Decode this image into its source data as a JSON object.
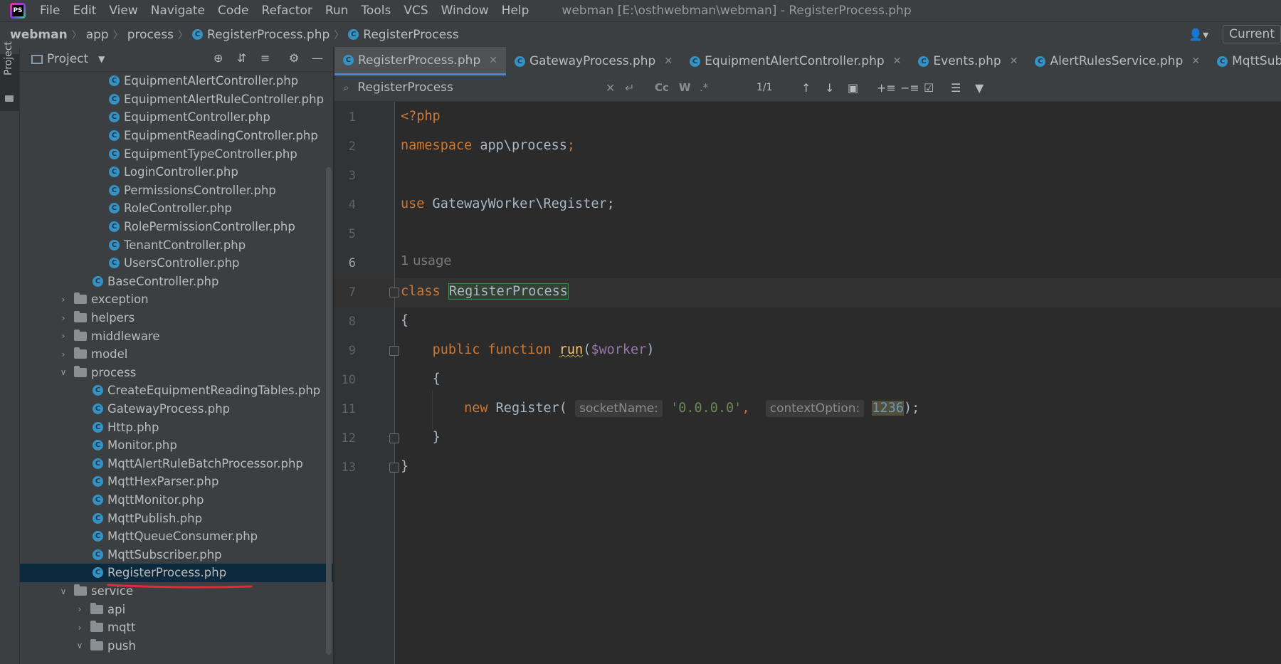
{
  "menu": {
    "items": [
      "File",
      "Edit",
      "View",
      "Navigate",
      "Code",
      "Refactor",
      "Run",
      "Tools",
      "VCS",
      "Window",
      "Help"
    ],
    "window_title": "webman [E:\\osthwebman\\webman] - RegisterProcess.php"
  },
  "breadcrumb": {
    "items": [
      "webman",
      "app",
      "process",
      "RegisterProcess.php",
      "RegisterProcess"
    ],
    "current_button": "Current"
  },
  "toolstrip": {
    "project_label": "Project"
  },
  "project_panel": {
    "title": "Project",
    "tree": [
      {
        "label": "EquipmentAlertController.php",
        "type": "file",
        "depth": 3
      },
      {
        "label": "EquipmentAlertRuleController.php",
        "type": "file",
        "depth": 3
      },
      {
        "label": "EquipmentController.php",
        "type": "file",
        "depth": 3
      },
      {
        "label": "EquipmentReadingController.php",
        "type": "file",
        "depth": 3
      },
      {
        "label": "EquipmentTypeController.php",
        "type": "file",
        "depth": 3
      },
      {
        "label": "LoginController.php",
        "type": "file",
        "depth": 3
      },
      {
        "label": "PermissionsController.php",
        "type": "file",
        "depth": 3
      },
      {
        "label": "RoleController.php",
        "type": "file",
        "depth": 3
      },
      {
        "label": "RolePermissionController.php",
        "type": "file",
        "depth": 3
      },
      {
        "label": "TenantController.php",
        "type": "file",
        "depth": 3
      },
      {
        "label": "UsersController.php",
        "type": "file",
        "depth": 3
      },
      {
        "label": "BaseController.php",
        "type": "file",
        "depth": 2
      },
      {
        "label": "exception",
        "type": "folder",
        "depth": 1,
        "expanded": false
      },
      {
        "label": "helpers",
        "type": "folder",
        "depth": 1,
        "expanded": false
      },
      {
        "label": "middleware",
        "type": "folder",
        "depth": 1,
        "expanded": false
      },
      {
        "label": "model",
        "type": "folder",
        "depth": 1,
        "expanded": false
      },
      {
        "label": "process",
        "type": "folder",
        "depth": 1,
        "expanded": true
      },
      {
        "label": "CreateEquipmentReadingTables.php",
        "type": "file",
        "depth": 2
      },
      {
        "label": "GatewayProcess.php",
        "type": "file",
        "depth": 2
      },
      {
        "label": "Http.php",
        "type": "file",
        "depth": 2
      },
      {
        "label": "Monitor.php",
        "type": "file",
        "depth": 2
      },
      {
        "label": "MqttAlertRuleBatchProcessor.php",
        "type": "file",
        "depth": 2
      },
      {
        "label": "MqttHexParser.php",
        "type": "file",
        "depth": 2
      },
      {
        "label": "MqttMonitor.php",
        "type": "file",
        "depth": 2
      },
      {
        "label": "MqttPublish.php",
        "type": "file",
        "depth": 2
      },
      {
        "label": "MqttQueueConsumer.php",
        "type": "file",
        "depth": 2
      },
      {
        "label": "MqttSubscriber.php",
        "type": "file",
        "depth": 2
      },
      {
        "label": "RegisterProcess.php",
        "type": "file",
        "depth": 2,
        "selected": true
      },
      {
        "label": "service",
        "type": "folder",
        "depth": 1,
        "expanded": true
      },
      {
        "label": "api",
        "type": "folder",
        "depth": 2,
        "expanded": false
      },
      {
        "label": "mqtt",
        "type": "folder",
        "depth": 2,
        "expanded": false
      },
      {
        "label": "push",
        "type": "folder",
        "depth": 2,
        "expanded": true
      }
    ]
  },
  "tabs": [
    {
      "label": "RegisterProcess.php",
      "active": true
    },
    {
      "label": "GatewayProcess.php",
      "active": false
    },
    {
      "label": "EquipmentAlertController.php",
      "active": false
    },
    {
      "label": "Events.php",
      "active": false
    },
    {
      "label": "AlertRulesService.php",
      "active": false
    },
    {
      "label": "MqttSubscriber.php",
      "active": false
    }
  ],
  "search": {
    "value": "RegisterProcess",
    "match_count": "1/1",
    "opt_case": "Cc",
    "opt_words": "W",
    "opt_regex": ".*"
  },
  "editor": {
    "line_numbers": [
      "1",
      "2",
      "3",
      "4",
      "5",
      "6",
      "7",
      "8",
      "9",
      "10",
      "11",
      "12",
      "13"
    ],
    "current_line": "6",
    "usage_hint": "1 usage",
    "code": {
      "l1": "<?php",
      "l2_kw": "namespace",
      "l2_rest": " app\\process",
      "l2_semi": ";",
      "l4_kw": "use",
      "l4_rest": " GatewayWorker\\Register;",
      "l6_kw": "class",
      "l6_name": "RegisterProcess",
      "l7": "{",
      "l8_kw1": "public",
      "l8_kw2": "function",
      "l8_fn": "run",
      "l8_open": "(",
      "l8_var": "$worker",
      "l8_close": ")",
      "l9": "{",
      "l10_kw": "new",
      "l10_cls": " Register(",
      "l10_hint1": "socketName:",
      "l10_str": "'0.0.0.0'",
      "l10_comma": ",",
      "l10_hint2": "contextOption:",
      "l10_num": "1236",
      "l10_end": ");",
      "l11": "}",
      "l12": "}"
    }
  },
  "colors": {
    "background": "#2b2b2b",
    "keyword": "#cc7832",
    "string": "#6a8759",
    "number": "#6897bb",
    "variable": "#9876aa",
    "function": "#ffc66d",
    "selection": "#0d293e",
    "annotation_underline": "#e8263a"
  },
  "icons": {
    "logo": "phpstorm-logo-icon",
    "class_file": "php-class-icon",
    "folder": "folder-icon",
    "search": "search-icon"
  }
}
